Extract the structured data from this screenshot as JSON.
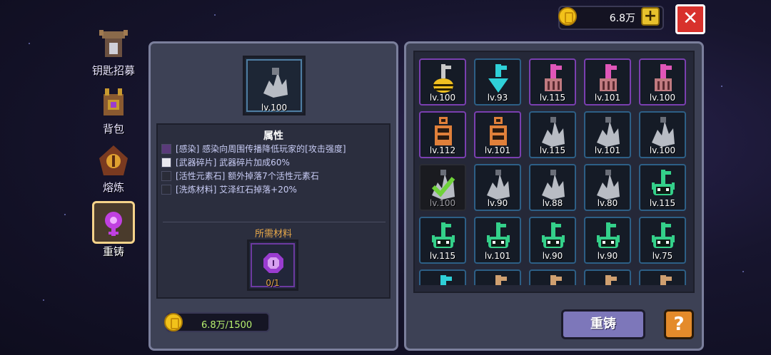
{
  "currency": {
    "amount": "6.8万",
    "plus_label": "+"
  },
  "close_label": "✕",
  "tabs": [
    {
      "label": "钥匙招募",
      "icon": "key-recruit-icon"
    },
    {
      "label": "背包",
      "icon": "backpack-icon"
    },
    {
      "label": "熔炼",
      "icon": "smelt-icon"
    },
    {
      "label": "重铸",
      "icon": "reforge-icon",
      "active": true
    }
  ],
  "selected_item": {
    "level": "lv.100",
    "icon": "gray-crystal-key-icon"
  },
  "attributes": {
    "title": "属性",
    "rows": [
      {
        "text": "[感染] 感染向周围传播降低玩家的[攻击强度]",
        "icon": "infect-icon"
      },
      {
        "text": "[武器碎片] 武器碎片加成60%",
        "icon": "fragment-icon"
      },
      {
        "text": "[活性元素石] 额外掉落7个活性元素石",
        "icon": "element-stone-icon"
      },
      {
        "text": "[洗炼材料] 艾泽红石掉落+20%",
        "icon": "refine-material-icon"
      }
    ]
  },
  "materials": {
    "title": "所需材料",
    "count": "0/1",
    "icon": "purple-gem-icon"
  },
  "cost": {
    "value": "6.8万/1500"
  },
  "grid": [
    {
      "level": "lv.100",
      "icon": "gold-key-icon",
      "color": "#f0c020",
      "border": "purple"
    },
    {
      "level": "lv.93",
      "icon": "cyan-key-icon",
      "color": "#2fd0d8",
      "border": "blue"
    },
    {
      "level": "lv.115",
      "icon": "pink-key-icon",
      "color": "#e056b8",
      "border": "purple"
    },
    {
      "level": "lv.101",
      "icon": "pink-key-icon",
      "color": "#e056b8",
      "border": "purple"
    },
    {
      "level": "lv.100",
      "icon": "pink-key-icon",
      "color": "#e056b8",
      "border": "purple"
    },
    {
      "level": "lv.112",
      "icon": "orange-key-icon",
      "color": "#e0803a",
      "border": "purple"
    },
    {
      "level": "lv.101",
      "icon": "orange-key-icon",
      "color": "#e0803a",
      "border": "purple"
    },
    {
      "level": "lv.115",
      "icon": "gray-crystal-key-icon",
      "color": "#b8bcc4",
      "border": "blue"
    },
    {
      "level": "lv.101",
      "icon": "gray-crystal-key-icon",
      "color": "#b8bcc4",
      "border": "blue"
    },
    {
      "level": "lv.100",
      "icon": "gray-crystal-key-icon",
      "color": "#b8bcc4",
      "border": "blue"
    },
    {
      "level": "lv.100",
      "icon": "gray-crystal-key-icon",
      "color": "#b8bcc4",
      "border": "gray",
      "selected": true
    },
    {
      "level": "lv.90",
      "icon": "gray-crystal-key-icon",
      "color": "#b8bcc4",
      "border": "blue"
    },
    {
      "level": "lv.88",
      "icon": "gray-crystal-key-icon",
      "color": "#b8bcc4",
      "border": "blue"
    },
    {
      "level": "lv.80",
      "icon": "gray-crystal-key-icon",
      "color": "#b8bcc4",
      "border": "blue"
    },
    {
      "level": "lv.115",
      "icon": "green-skull-key-icon",
      "color": "#34d08a",
      "border": "blue"
    },
    {
      "level": "lv.115",
      "icon": "green-skull-key-icon",
      "color": "#34d08a",
      "border": "blue"
    },
    {
      "level": "lv.101",
      "icon": "green-skull-key-icon",
      "color": "#34d08a",
      "border": "blue"
    },
    {
      "level": "lv.90",
      "icon": "green-skull-key-icon",
      "color": "#34d08a",
      "border": "blue"
    },
    {
      "level": "lv.90",
      "icon": "green-skull-key-icon",
      "color": "#34d08a",
      "border": "blue"
    },
    {
      "level": "lv.75",
      "icon": "green-skull-key-icon",
      "color": "#34d08a",
      "border": "blue"
    },
    {
      "level": "",
      "icon": "cyan-key-icon",
      "color": "#2fd0d8",
      "border": "blue"
    },
    {
      "level": "",
      "icon": "tan-key-icon",
      "color": "#d0a070",
      "border": "blue"
    },
    {
      "level": "",
      "icon": "tan-key-icon",
      "color": "#d0a070",
      "border": "blue"
    },
    {
      "level": "",
      "icon": "tan-key-icon",
      "color": "#d0a070",
      "border": "blue"
    },
    {
      "level": "",
      "icon": "tan-key-icon",
      "color": "#d0a070",
      "border": "blue"
    }
  ],
  "buttons": {
    "reforge": "重铸",
    "help": "?"
  }
}
